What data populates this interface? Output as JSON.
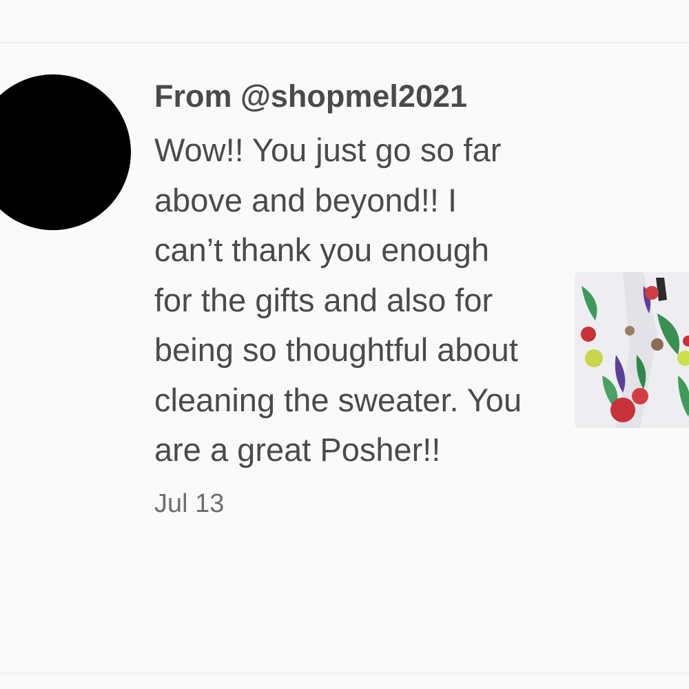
{
  "review": {
    "from_label": "From @shopmel2021",
    "message": "Wow!! You just go so far above and beyond!! I can’t thank you enough for the gifts and also for being so thoughtful about cleaning the sweater. You are a great Posher!!",
    "date": "Jul 13"
  },
  "colors": {
    "text": "#4a4a4a",
    "date_text": "#6e6e6e",
    "background": "#fafafa",
    "divider": "#ececec",
    "avatar": "#000000"
  },
  "icons": {
    "avatar": "user-avatar",
    "thumbnail": "floral-garment-photo"
  }
}
